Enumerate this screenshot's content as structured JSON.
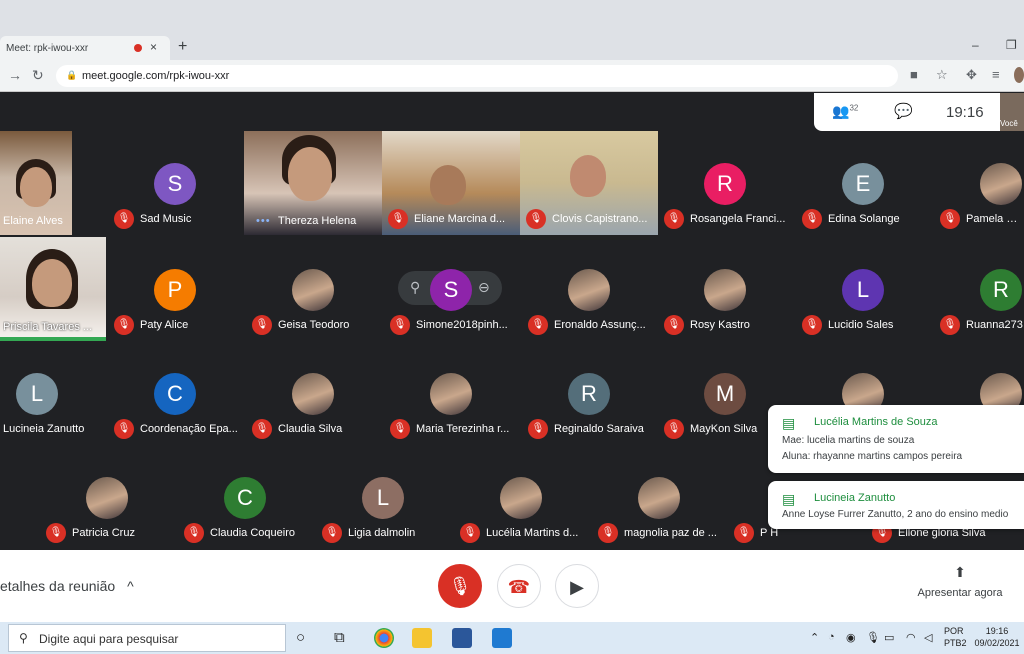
{
  "browser": {
    "tab_title": "Meet: rpk-iwou-xxr",
    "tab_close": "×",
    "new_tab": "+",
    "minimize": "–",
    "restore": "❐",
    "back": "→",
    "reload": "↻",
    "url": "meet.google.com/rpk-iwou-xxr"
  },
  "meet": {
    "participant_count": "32",
    "clock": "19:16",
    "self_label": "Você",
    "participants": [
      {
        "name": "Elaine Alves"
      },
      {
        "name": "Sad Music",
        "initial": "S",
        "color": "#7e57c2"
      },
      {
        "name": "Thereza Helena"
      },
      {
        "name": "Eliane Marcina d..."
      },
      {
        "name": "Clovis Capistrano..."
      },
      {
        "name": "Rosangela Franci...",
        "initial": "R",
        "color": "#e91e63"
      },
      {
        "name": "Edina Solange",
        "initial": "E",
        "color": "#78909c"
      },
      {
        "name": "Pamela Cor"
      },
      {
        "name": "Priscila Tavares ..."
      },
      {
        "name": "Paty Alice",
        "initial": "P",
        "color": "#f57c00"
      },
      {
        "name": "Geisa Teodoro"
      },
      {
        "name": "Simone2018pinh...",
        "initial": "S",
        "color": "#8e24aa"
      },
      {
        "name": "Eronaldo Assunç..."
      },
      {
        "name": "Rosy Kastro"
      },
      {
        "name": "Lucidio Sales",
        "initial": "L",
        "color": "#5e35b1"
      },
      {
        "name": "Ruanna273",
        "initial": "R",
        "color": "#2e7d32"
      },
      {
        "name": "Lucineia Zanutto",
        "initial": "L",
        "color": "#78909c"
      },
      {
        "name": "Coordenação Epa...",
        "initial": "C",
        "color": "#1565c0"
      },
      {
        "name": "Claudia Silva"
      },
      {
        "name": "Maria Terezinha r..."
      },
      {
        "name": "Reginaldo Saraiva",
        "initial": "R",
        "color": "#546e7a"
      },
      {
        "name": "MayKon Silva",
        "initial": "M",
        "color": "#6d4c41"
      },
      {
        "name": "Patricia Cruz"
      },
      {
        "name": "Claudia Coqueiro",
        "initial": "C",
        "color": "#2e7d32"
      },
      {
        "name": "Ligia dalmolin",
        "initial": "L",
        "color": "#8d6e63"
      },
      {
        "name": "Lucélia Martins d..."
      },
      {
        "name": "magnolia paz de ..."
      },
      {
        "name": "P H"
      },
      {
        "name": "Ellone gloria Silva"
      }
    ],
    "toasts": [
      {
        "title": "Lucélia Martins de Souza",
        "lines": [
          "Mae: lucelia martins de souza",
          "Aluna: rhayanne martins campos pereira"
        ]
      },
      {
        "title": "Lucineia Zanutto",
        "lines": [
          "Anne Loyse Furrer Zanutto, 2 ano do ensino medio"
        ]
      }
    ]
  },
  "bottom": {
    "details": "etalhes da reunião",
    "details_chevron": "^",
    "present": "Apresentar agora"
  },
  "taskbar": {
    "search_placeholder": "Digite aqui para pesquisar",
    "lang_top": "POR",
    "lang_bottom": "PTB2",
    "time": "19:16",
    "date": "09/02/2021"
  },
  "colors": {
    "meet_bg": "#202124",
    "mic_off": "#d93025",
    "chat_green": "#1e8e3e",
    "speaking_green": "#34a853"
  }
}
